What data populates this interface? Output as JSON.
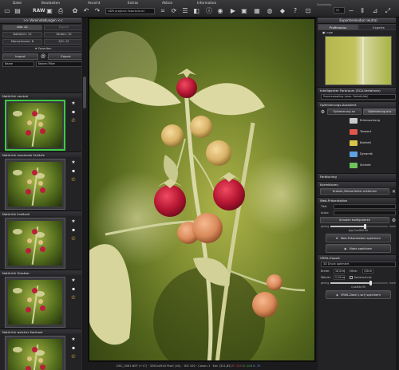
{
  "menu": {
    "items": [
      "Datei",
      "Bearbeiten",
      "Ansicht",
      "Extras",
      "Aktion",
      "Information"
    ]
  },
  "toolbar": {
    "raw_label": "RAW",
    "profile_select": "HDR projects Fotorechner",
    "zoom_label": "Zoomfaktor",
    "zoom_value": "21",
    "compare_label": "Vorher",
    "compare2_label": "Nachher"
  },
  "left": {
    "header": ">> Voreinstellungen <<",
    "tabs_row1": [
      "Alle: 42",
      "Eigene"
    ],
    "tabs_row2": [
      "Natürlich: 12",
      "Farben: 10"
    ],
    "tabs_row3": [
      "Monochrome: 8",
      "S/O: 12"
    ],
    "favorites": "★ Favoriten",
    "import_label": "Import",
    "export_label": "Export",
    "filter_select": "Name",
    "filter_select2": "Keinen Filter",
    "presets": [
      {
        "title": "Natürlich neutral",
        "selected": true
      },
      {
        "title": "Natürlich maximale Schärfe",
        "selected": false
      },
      {
        "title": "Natürlich kraftvoll",
        "selected": false
      },
      {
        "title": "Natürlich Glasklar",
        "selected": false
      },
      {
        "title": "Natürlich weicher Kontrast",
        "selected": false
      }
    ]
  },
  "right": {
    "tabs": [
      "Profimodus",
      "Experte"
    ],
    "panel_title": "Expertenmodus neutral",
    "lupe_label": "Lupe",
    "sca_title": "Intelligenter Farbraum (SCA-Verfahren)",
    "sca_select": "Supersampling (max. Farbdichte)",
    "opt_title": "Optimierungs-Assistent",
    "opt_btn1": "Optimierung an",
    "opt_btn2": "Optimierung aus",
    "opt_items": [
      "Entrauschung",
      "Tonwert",
      "Klarheit",
      "Dynamik",
      "Schärfe"
    ],
    "farbtuning_title": "Farbtuning",
    "korrektur_title": "Korrekturen",
    "korrektur_btn": "Kratzer-/Sensorfehler entfernen",
    "web_title": "Web-Präsentation",
    "titel_label": "Titel:",
    "autor_label": "Autor:",
    "annot_btn": "Annoten konfigurieren",
    "slider_left": "gering",
    "slider_mid": "Jpg-Qualität 80",
    "slider_right": "hoch",
    "web_save_btn": "Web-Präsentation speichern",
    "video_btn": "Video speichern",
    "vrml_title": "VRML-Export",
    "vrml_select": "3D Druck optimiert",
    "breite_label": "Breite:",
    "breite_value": "18,0cm",
    "hoehe_label": "Höhe:",
    "hoehe_value": "4,6cm",
    "waende_label": "Wände:",
    "waende_value": "0,20cm",
    "kartenschutz_label": "Kartenschutz",
    "quality_left": "gering",
    "quality_mid": "Qualität 90",
    "quality_right": "hoch",
    "vrml_save_btn": "VRML-Datei (.wrl) speichern"
  },
  "statusbar": {
    "text": "DSC_0061.NEF (+17) · 3262x4944 Pixel (16). · ISO 100 · Canon-1 · Eon",
    "coords": "(321,82)",
    "r": "R: 133",
    "g": "G: 104",
    "b": "B: 39"
  }
}
